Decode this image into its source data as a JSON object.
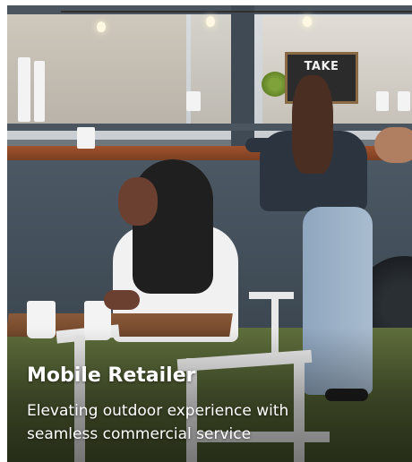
{
  "card": {
    "title": "Mobile Retailer",
    "subtitle_line1": "Elevating outdoor experience with",
    "subtitle_line2": "seamless commercial service"
  },
  "scene": {
    "sign_text": "TAKE"
  },
  "colors": {
    "text": "#ffffff",
    "truck": "#3f4a55",
    "counter": "#a0522d"
  }
}
